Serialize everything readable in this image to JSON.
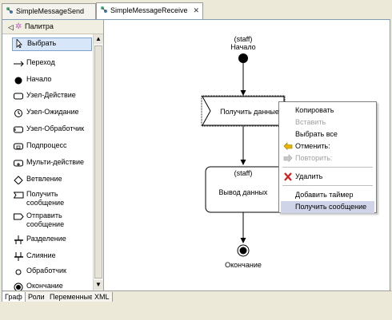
{
  "tabs": [
    {
      "label": "SimpleMessageSend",
      "active": false
    },
    {
      "label": "SimpleMessageReceive",
      "active": true
    }
  ],
  "palette": {
    "title": "Палитра",
    "items": [
      {
        "label": "Выбрать",
        "icon": "cursor-icon",
        "selected": true
      },
      {
        "label": "Переход",
        "icon": "arrow-icon"
      },
      {
        "label": "Начало",
        "icon": "start-node-icon"
      },
      {
        "label": "Узел-Действие",
        "icon": "action-node-icon"
      },
      {
        "label": "Узел-Ожидание",
        "icon": "wait-node-icon"
      },
      {
        "label": "Узел-Обработчик",
        "icon": "handler-node-icon"
      },
      {
        "label": "Подпроцесс",
        "icon": "subprocess-icon"
      },
      {
        "label": "Мульти-действие",
        "icon": "multi-action-icon"
      },
      {
        "label": "Ветвление",
        "icon": "decision-icon"
      },
      {
        "label": "Получить сообщение",
        "lines": [
          "Получить",
          "сообщение"
        ],
        "icon": "receive-message-icon"
      },
      {
        "label": "Отправить сообщение",
        "lines": [
          "Отправить",
          "сообщение"
        ],
        "icon": "send-message-icon"
      },
      {
        "label": "Разделение",
        "icon": "fork-icon"
      },
      {
        "label": "Слияние",
        "icon": "join-icon"
      },
      {
        "label": "Обработчик",
        "icon": "event-handler-icon"
      },
      {
        "label": "Окончание",
        "icon": "end-node-icon"
      }
    ]
  },
  "diagram": {
    "start": {
      "role": "(staff)",
      "label": "Начало"
    },
    "receive_node": {
      "label": "Получить данные"
    },
    "task_node": {
      "role": "(staff)",
      "label": "Вывод данных"
    },
    "end": {
      "label": "Окончание"
    }
  },
  "context_menu": {
    "items": [
      {
        "label": "Копировать",
        "enabled": true
      },
      {
        "label": "Вставить",
        "enabled": false
      },
      {
        "label": "Выбрать все",
        "enabled": true
      },
      {
        "label": "Отменить:",
        "enabled": true,
        "icon": "undo-icon"
      },
      {
        "label": "Повторить:",
        "enabled": false,
        "icon": "redo-icon"
      },
      {
        "label": "Удалить",
        "enabled": true,
        "icon": "delete-icon"
      },
      {
        "label": "Добавить таймер",
        "enabled": true
      },
      {
        "label": "Получить сообщение",
        "enabled": true,
        "highlighted": true
      }
    ]
  },
  "bottom_tabs": [
    {
      "label": "Граф",
      "active": true
    },
    {
      "label": "Роли",
      "active": false
    },
    {
      "label": "Переменные",
      "active": false
    },
    {
      "label": "XML",
      "active": false
    }
  ],
  "colors": {
    "undo": "#e8b400",
    "delete": "#d02020",
    "highlight": "#d0d4e8",
    "palette_selected": "#d8e6f9"
  }
}
